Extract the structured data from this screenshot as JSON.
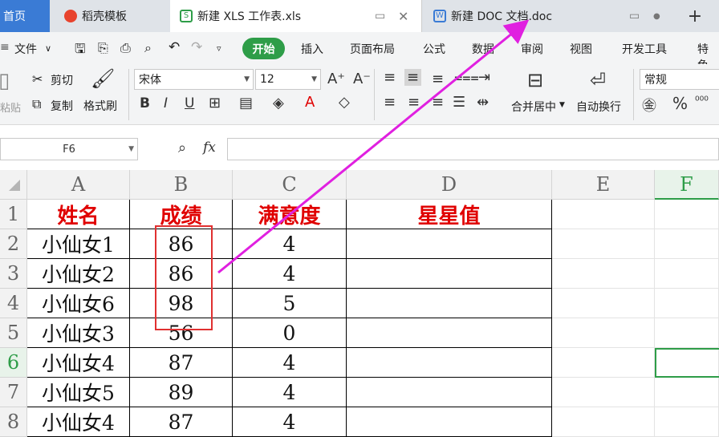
{
  "tabs": {
    "home": "首页",
    "t1": "稻壳模板",
    "t2": "新建 XLS 工作表.xls",
    "t3": "新建 DOC 文档.doc"
  },
  "menu": {
    "file": "文件",
    "start": "开始",
    "items": [
      "插入",
      "页面布局",
      "公式",
      "数据",
      "审阅",
      "视图",
      "开发工具",
      "特色"
    ]
  },
  "ribbon": {
    "paste": "粘贴",
    "cut": "剪切",
    "copy": "复制",
    "format_painter": "格式刷",
    "font": "宋体",
    "size": "12",
    "merge": "合并居中",
    "wrap": "自动换行",
    "number_format": "常规"
  },
  "formula_bar": {
    "cell_ref": "F6",
    "fx": "fx",
    "content": ""
  },
  "columns": [
    "A",
    "B",
    "C",
    "D",
    "E",
    "F"
  ],
  "rows": [
    "1",
    "2",
    "3",
    "4",
    "5",
    "6",
    "7",
    "8"
  ],
  "table": {
    "headers": [
      "姓名",
      "成绩",
      "满意度",
      "星星值"
    ],
    "rows": [
      [
        "小仙女1",
        "86",
        "4",
        ""
      ],
      [
        "小仙女2",
        "86",
        "4",
        ""
      ],
      [
        "小仙女6",
        "98",
        "5",
        ""
      ],
      [
        "小仙女3",
        "56",
        "0",
        ""
      ],
      [
        "小仙女4",
        "87",
        "4",
        ""
      ],
      [
        "小仙女5",
        "89",
        "4",
        ""
      ],
      [
        "小仙女4",
        "87",
        "4",
        ""
      ]
    ]
  },
  "colors": {
    "accent": "#2e9d48",
    "header_text": "#e00000",
    "annotation_box": "#e03030",
    "annotation_arrow": "#e020e0"
  }
}
